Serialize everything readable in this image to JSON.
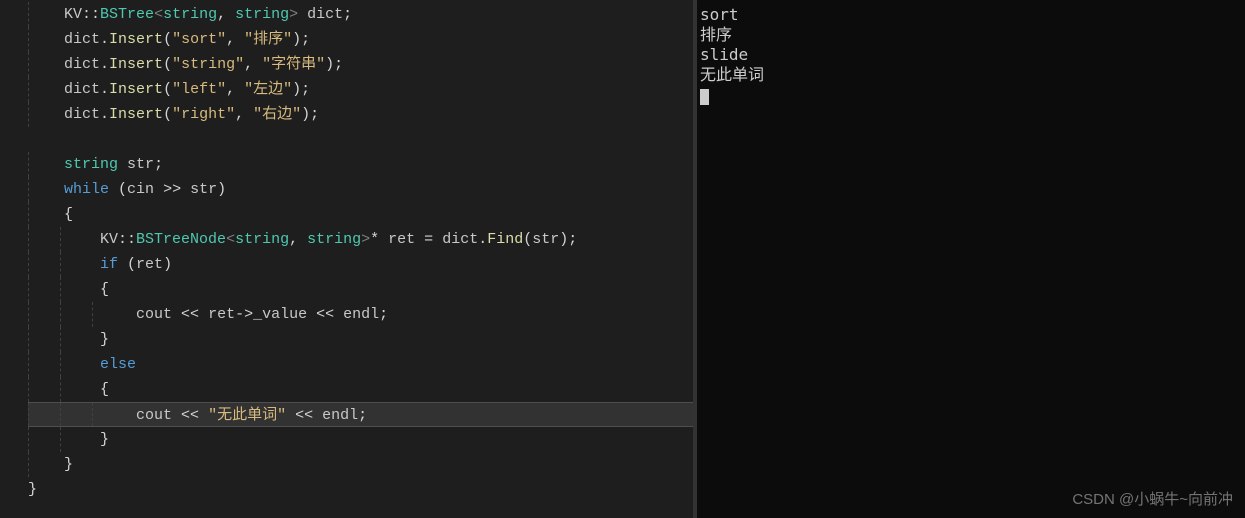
{
  "code": {
    "lines": [
      {
        "indent": 1,
        "tokens": [
          [
            "ns",
            "KV"
          ],
          [
            "punct",
            "::"
          ],
          [
            "type",
            "BSTree"
          ],
          [
            "angle",
            "<"
          ],
          [
            "type",
            "string"
          ],
          [
            "punct",
            ", "
          ],
          [
            "type",
            "string"
          ],
          [
            "angle",
            ">"
          ],
          [
            "punct",
            " "
          ],
          [
            "ident",
            "dict"
          ],
          [
            "punct",
            ";"
          ]
        ]
      },
      {
        "indent": 1,
        "tokens": [
          [
            "ident",
            "dict"
          ],
          [
            "punct",
            "."
          ],
          [
            "func",
            "Insert"
          ],
          [
            "punct",
            "("
          ],
          [
            "string",
            "\"sort\""
          ],
          [
            "punct",
            ", "
          ],
          [
            "string",
            "\"排序\""
          ],
          [
            "punct",
            ");"
          ]
        ]
      },
      {
        "indent": 1,
        "tokens": [
          [
            "ident",
            "dict"
          ],
          [
            "punct",
            "."
          ],
          [
            "func",
            "Insert"
          ],
          [
            "punct",
            "("
          ],
          [
            "string",
            "\"string\""
          ],
          [
            "punct",
            ", "
          ],
          [
            "string",
            "\"字符串\""
          ],
          [
            "punct",
            ");"
          ]
        ]
      },
      {
        "indent": 1,
        "tokens": [
          [
            "ident",
            "dict"
          ],
          [
            "punct",
            "."
          ],
          [
            "func",
            "Insert"
          ],
          [
            "punct",
            "("
          ],
          [
            "string",
            "\"left\""
          ],
          [
            "punct",
            ", "
          ],
          [
            "string",
            "\"左边\""
          ],
          [
            "punct",
            ");"
          ]
        ]
      },
      {
        "indent": 1,
        "tokens": [
          [
            "ident",
            "dict"
          ],
          [
            "punct",
            "."
          ],
          [
            "func",
            "Insert"
          ],
          [
            "punct",
            "("
          ],
          [
            "string",
            "\"right\""
          ],
          [
            "punct",
            ", "
          ],
          [
            "string",
            "\"右边\""
          ],
          [
            "punct",
            ");"
          ]
        ]
      },
      {
        "indent": 0,
        "tokens": []
      },
      {
        "indent": 1,
        "tokens": [
          [
            "type",
            "string"
          ],
          [
            "punct",
            " "
          ],
          [
            "ident",
            "str"
          ],
          [
            "punct",
            ";"
          ]
        ]
      },
      {
        "indent": 1,
        "tokens": [
          [
            "keyword",
            "while"
          ],
          [
            "punct",
            " ("
          ],
          [
            "ident",
            "cin"
          ],
          [
            "op",
            " >> "
          ],
          [
            "ident",
            "str"
          ],
          [
            "punct",
            ")"
          ]
        ]
      },
      {
        "indent": 1,
        "tokens": [
          [
            "punct",
            "{"
          ]
        ]
      },
      {
        "indent": 2,
        "tokens": [
          [
            "ns",
            "KV"
          ],
          [
            "punct",
            "::"
          ],
          [
            "type",
            "BSTreeNode"
          ],
          [
            "angle",
            "<"
          ],
          [
            "type",
            "string"
          ],
          [
            "punct",
            ", "
          ],
          [
            "type",
            "string"
          ],
          [
            "angle",
            ">"
          ],
          [
            "punct",
            "* "
          ],
          [
            "ident",
            "ret"
          ],
          [
            "op",
            " = "
          ],
          [
            "ident",
            "dict"
          ],
          [
            "punct",
            "."
          ],
          [
            "func",
            "Find"
          ],
          [
            "punct",
            "("
          ],
          [
            "ident",
            "str"
          ],
          [
            "punct",
            ");"
          ]
        ]
      },
      {
        "indent": 2,
        "tokens": [
          [
            "keyword",
            "if"
          ],
          [
            "punct",
            " ("
          ],
          [
            "ident",
            "ret"
          ],
          [
            "punct",
            ")"
          ]
        ]
      },
      {
        "indent": 2,
        "tokens": [
          [
            "punct",
            "{"
          ]
        ]
      },
      {
        "indent": 3,
        "tokens": [
          [
            "ident",
            "cout"
          ],
          [
            "op",
            " << "
          ],
          [
            "ident",
            "ret"
          ],
          [
            "op",
            "->"
          ],
          [
            "member",
            "_value"
          ],
          [
            "op",
            " << "
          ],
          [
            "ident",
            "endl"
          ],
          [
            "punct",
            ";"
          ]
        ]
      },
      {
        "indent": 2,
        "tokens": [
          [
            "punct",
            "}"
          ]
        ]
      },
      {
        "indent": 2,
        "tokens": [
          [
            "keyword",
            "else"
          ]
        ]
      },
      {
        "indent": 2,
        "tokens": [
          [
            "punct",
            "{"
          ]
        ]
      },
      {
        "indent": 3,
        "highlighted": true,
        "tokens": [
          [
            "ident",
            "cout"
          ],
          [
            "op",
            " << "
          ],
          [
            "string",
            "\"无此单词\""
          ],
          [
            "op",
            " << "
          ],
          [
            "ident",
            "endl"
          ],
          [
            "punct",
            ";"
          ]
        ]
      },
      {
        "indent": 2,
        "tokens": [
          [
            "punct",
            "}"
          ]
        ]
      },
      {
        "indent": 1,
        "tokens": [
          [
            "punct",
            "}"
          ]
        ]
      },
      {
        "indent": 0,
        "tokens": [
          [
            "punct",
            "}"
          ]
        ]
      }
    ],
    "indent_unit": "    "
  },
  "terminal": {
    "lines": [
      "sort",
      "排序",
      "slide",
      "无此单词"
    ]
  },
  "watermark": "CSDN @小蜗牛~向前冲"
}
